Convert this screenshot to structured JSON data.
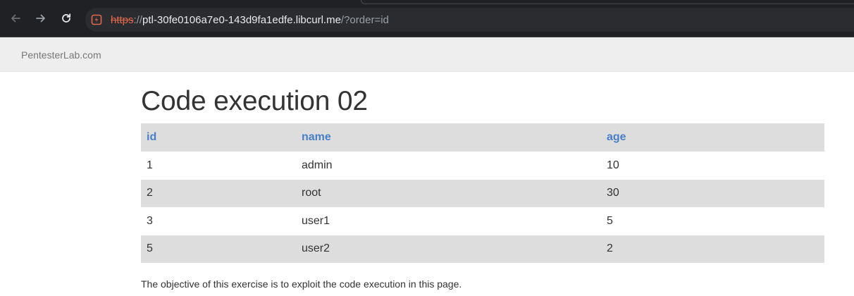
{
  "browser": {
    "url": {
      "scheme": "https",
      "separator": "://",
      "host": "ptl-30fe0106a7e0-143d9fa1edfe.libcurl.me",
      "path": "/?order=id"
    },
    "icons": {
      "back": "arrow-left-icon",
      "forward": "arrow-right-icon",
      "reload": "reload-icon",
      "site": "not-secure-icon"
    },
    "colors": {
      "scheme_warning": "#e0684f"
    }
  },
  "header": {
    "brand": "PentesterLab.com"
  },
  "main": {
    "title": "Code execution 02",
    "table": {
      "columns": [
        "id",
        "name",
        "age"
      ],
      "rows": [
        [
          "1",
          "admin",
          "10"
        ],
        [
          "2",
          "root",
          "30"
        ],
        [
          "3",
          "user1",
          "5"
        ],
        [
          "5",
          "user2",
          "2"
        ]
      ]
    },
    "objective": "The objective of this exercise is to exploit the code execution in this page.",
    "colors": {
      "header_link": "#4a7fc7",
      "stripe": "#dddddd"
    }
  }
}
